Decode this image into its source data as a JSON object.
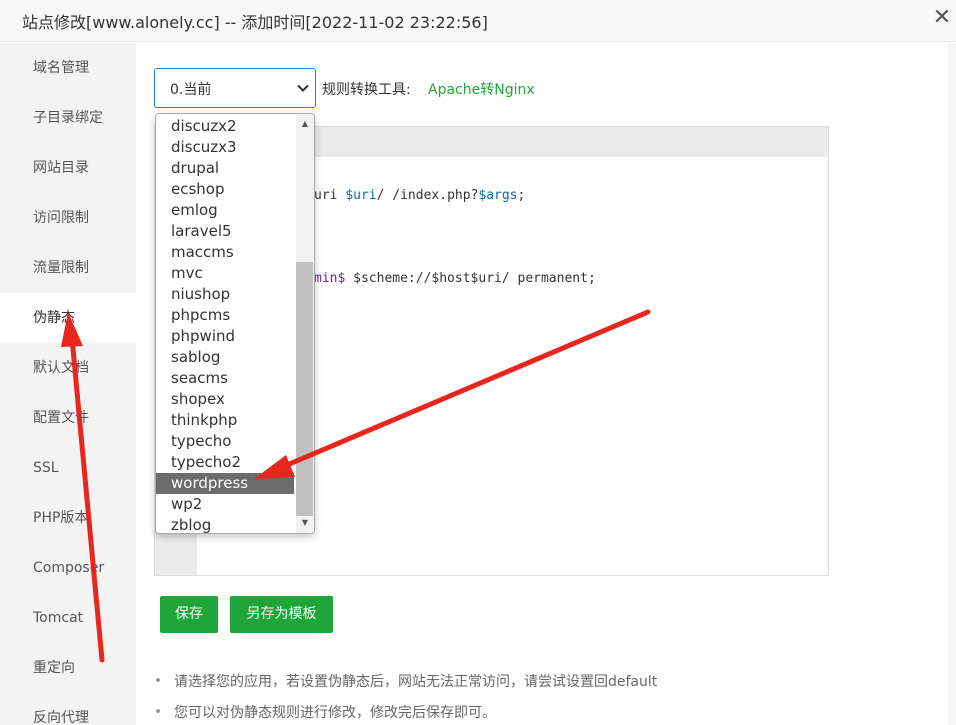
{
  "window": {
    "title": "站点修改[www.alonely.cc] -- 添加时间[2022-11-02 23:22:56]",
    "close_glyph": "✕"
  },
  "sidebar": {
    "items": [
      {
        "label": "域名管理"
      },
      {
        "label": "子目录绑定"
      },
      {
        "label": "网站目录"
      },
      {
        "label": "访问限制"
      },
      {
        "label": "流量限制"
      },
      {
        "label": "伪静态",
        "active": true
      },
      {
        "label": "默认文档"
      },
      {
        "label": "配置文件"
      },
      {
        "label": "SSL"
      },
      {
        "label": "PHP版本"
      },
      {
        "label": "Composer"
      },
      {
        "label": "Tomcat"
      },
      {
        "label": "重定向"
      },
      {
        "label": "反向代理"
      }
    ]
  },
  "rewrite": {
    "select_value": "0.当前",
    "tool_label": "规则转换工具:",
    "tool_link": "Apache转Nginx",
    "options": [
      "discuzx2",
      "discuzx3",
      "drupal",
      "ecshop",
      "emlog",
      "laravel5",
      "maccms",
      "mvc",
      "niushop",
      "phpcms",
      "phpwind",
      "sablog",
      "seacms",
      "shopex",
      "thinkphp",
      "typecho",
      "typecho2",
      "wordpress",
      "wp2",
      "zblog"
    ],
    "selected_option": "wordpress",
    "code_line1": {
      "pre": "uri ",
      "var1": "$uri",
      "mid": "/ /index.php?",
      "var2": "$args",
      "post": ";"
    },
    "code_line2": {
      "pre": "",
      "kw": "min$",
      "post": " $scheme://$host$uri/ permanent;"
    }
  },
  "buttons": {
    "save": "保存",
    "save_as_template": "另存为模板"
  },
  "tips": [
    "请选择您的应用，若设置伪静态后，网站无法正常访问，请尝试设置回default",
    "您可以对伪静态规则进行修改，修改完后保存即可。"
  ],
  "colors": {
    "accent_green": "#20a53a",
    "arrow_red": "#e8261e",
    "select_border": "#2c7ed6"
  }
}
